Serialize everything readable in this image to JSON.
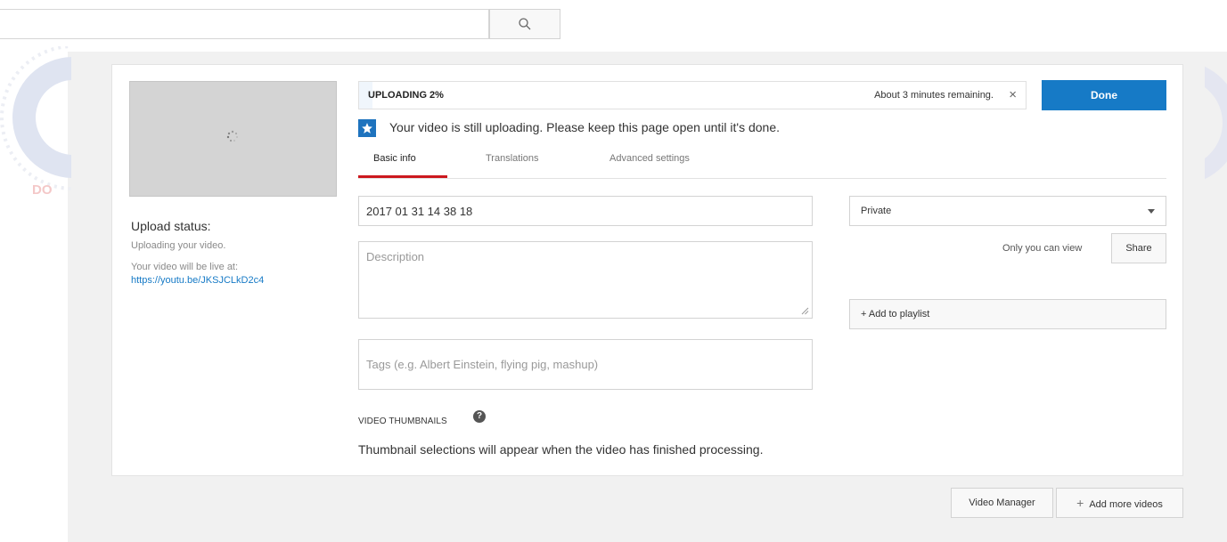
{
  "colors": {
    "accent_blue": "#167ac6",
    "tab_underline_red": "#cc181e",
    "star_badge_blue": "#1e73be",
    "page_gray": "#f1f1f1"
  },
  "search": {
    "value": "",
    "icon": "search-icon"
  },
  "upload": {
    "progress_label": "UPLOADING 2%",
    "progress_fraction": 0.02,
    "remaining": "About 3 minutes remaining.",
    "close_icon": "close-icon",
    "done_label": "Done",
    "notice": "Your video is still uploading. Please keep this page open until it's done.",
    "notice_icon": "star-icon"
  },
  "tabs": [
    {
      "label": "Basic info",
      "active": true
    },
    {
      "label": "Translations",
      "active": false
    },
    {
      "label": "Advanced settings",
      "active": false
    }
  ],
  "form": {
    "title_value": "2017 01 31 14 38 18",
    "description_placeholder": "Description",
    "tags_placeholder": "Tags (e.g. Albert Einstein, flying pig, mashup)",
    "thumbnails_title": "VIDEO THUMBNAILS",
    "thumbnails_text": "Thumbnail selections will appear when the video has finished processing."
  },
  "status": {
    "title": "Upload status:",
    "text": "Uploading your video.",
    "live_at": "Your video will be live at:",
    "link": "https://youtu.be/JKSJCLkD2c4"
  },
  "privacy": {
    "selected": "Private",
    "caption": "Only you can view",
    "share_label": "Share",
    "playlist_label": "+ Add to playlist"
  },
  "footer": {
    "video_manager": "Video Manager",
    "add_more": "Add more videos"
  }
}
